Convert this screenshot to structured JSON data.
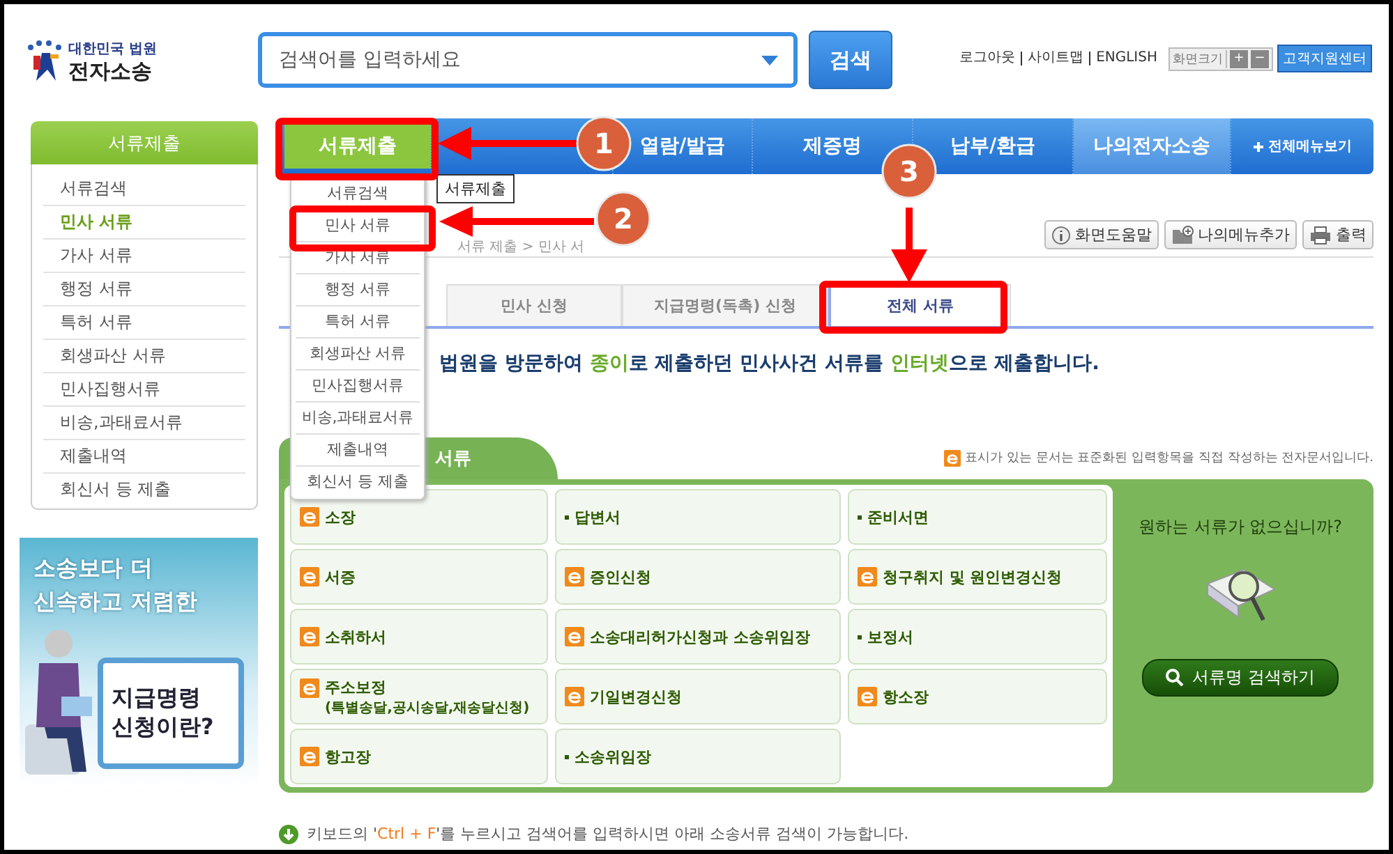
{
  "logo": {
    "top": "대한민국 법원",
    "name": "전자소송"
  },
  "search": {
    "placeholder": "검색어를 입력하세요",
    "button": "검색"
  },
  "top_links": [
    "로그아웃",
    "사이트맵",
    "ENGLISH"
  ],
  "font_size": {
    "label": "화면크기",
    "increase": "+",
    "decrease": "−"
  },
  "support_button": "고객지원센터",
  "sidebar": {
    "title": "서류제출",
    "items": [
      {
        "label": "서류검색",
        "selected": false
      },
      {
        "label": "민사 서류",
        "selected": true
      },
      {
        "label": "가사 서류",
        "selected": false
      },
      {
        "label": "행정 서류",
        "selected": false
      },
      {
        "label": "특허 서류",
        "selected": false
      },
      {
        "label": "회생파산 서류",
        "selected": false
      },
      {
        "label": "민사집행서류",
        "selected": false
      },
      {
        "label": "비송,과태료서류",
        "selected": false
      },
      {
        "label": "제출내역",
        "selected": false
      },
      {
        "label": "회신서 등 제출",
        "selected": false
      }
    ]
  },
  "banner": {
    "lines": [
      "소송보다 더",
      "신속하고 저렴한"
    ],
    "card": [
      "지급명령",
      "신청이란?"
    ]
  },
  "nav": {
    "items": [
      {
        "label": "서류제출",
        "selected": true,
        "highlighted": false
      },
      {
        "selected": false,
        "highlighted": false
      },
      {
        "label": "열람/발급",
        "selected": false,
        "highlighted": false
      },
      {
        "label": "제증명",
        "selected": false,
        "highlighted": false
      },
      {
        "label": "납부/환급",
        "selected": false,
        "highlighted": false
      },
      {
        "label": "나의전자소송",
        "selected": false,
        "highlighted": true
      }
    ],
    "all_menu": "전체메뉴보기"
  },
  "tooltip": "서류제출",
  "dropdown": {
    "items": [
      "서류검색",
      "민사 서류",
      "가사 서류",
      "행정 서류",
      "특허 서류",
      "회생파산 서류",
      "민사집행서류",
      "비송,과태료서류",
      "제출내역",
      "회신서 등 제출"
    ]
  },
  "breadcrumb": "서류 제출 > 민사 서",
  "tools": [
    {
      "kind": "info",
      "label": "화면도움말"
    },
    {
      "kind": "folder",
      "label": "나의메뉴추가"
    },
    {
      "kind": "print",
      "label": "출력"
    }
  ],
  "tabs": [
    {
      "label": "민사 신청",
      "selected": false
    },
    {
      "label": "지급명령(독촉) 신청",
      "selected": false
    },
    {
      "label": "전체 서류",
      "selected": true
    }
  ],
  "intro": [
    {
      "text": "법원을 방문하여 ",
      "highlight": false
    },
    {
      "text": "종이",
      "highlight": true
    },
    {
      "text": "로 제출하던 민사사건 서류를 ",
      "highlight": false
    },
    {
      "text": "인터넷",
      "highlight": true
    },
    {
      "text": "으로 제출합니다.",
      "highlight": false
    }
  ],
  "panel": {
    "title": "서류",
    "note": "표시가 있는 문서는 표준화된 입력항목을 직접 작성하는 전자문서입니다.",
    "documents": [
      {
        "kind": "electronic",
        "label": "소장"
      },
      {
        "kind": "plain",
        "label": "답변서"
      },
      {
        "kind": "plain",
        "label": "준비서면"
      },
      {
        "kind": "electronic",
        "label": "서증"
      },
      {
        "kind": "electronic",
        "label": "증인신청"
      },
      {
        "kind": "electronic",
        "label": "청구취지 및 원인변경신청"
      },
      {
        "kind": "electronic",
        "label": "소취하서"
      },
      {
        "kind": "electronic",
        "label": "소송대리허가신청과 소송위임장"
      },
      {
        "kind": "plain",
        "label": "보정서"
      },
      {
        "kind": "electronic",
        "label": "주소보정",
        "sub": "(특별송달,공시송달,재송달신청)"
      },
      {
        "kind": "electronic",
        "label": "기일변경신청"
      },
      {
        "kind": "electronic",
        "label": "항소장"
      },
      {
        "kind": "electronic",
        "label": "항고장"
      },
      {
        "kind": "plain",
        "label": "소송위임장"
      }
    ],
    "side_question": "원하는 서류가 없으십니까?",
    "side_button": "서류명 검색하기"
  },
  "footer": [
    {
      "text": "키보드의 '",
      "highlight": false
    },
    {
      "text": "Ctrl + F",
      "highlight": true
    },
    {
      "text": "'를 누르시고 검색어를 입력하시면 아래 소송서류 검색이 가능합니다.",
      "highlight": false
    }
  ],
  "annotations": [
    {
      "number": "1"
    },
    {
      "number": "2"
    },
    {
      "number": "3"
    }
  ]
}
